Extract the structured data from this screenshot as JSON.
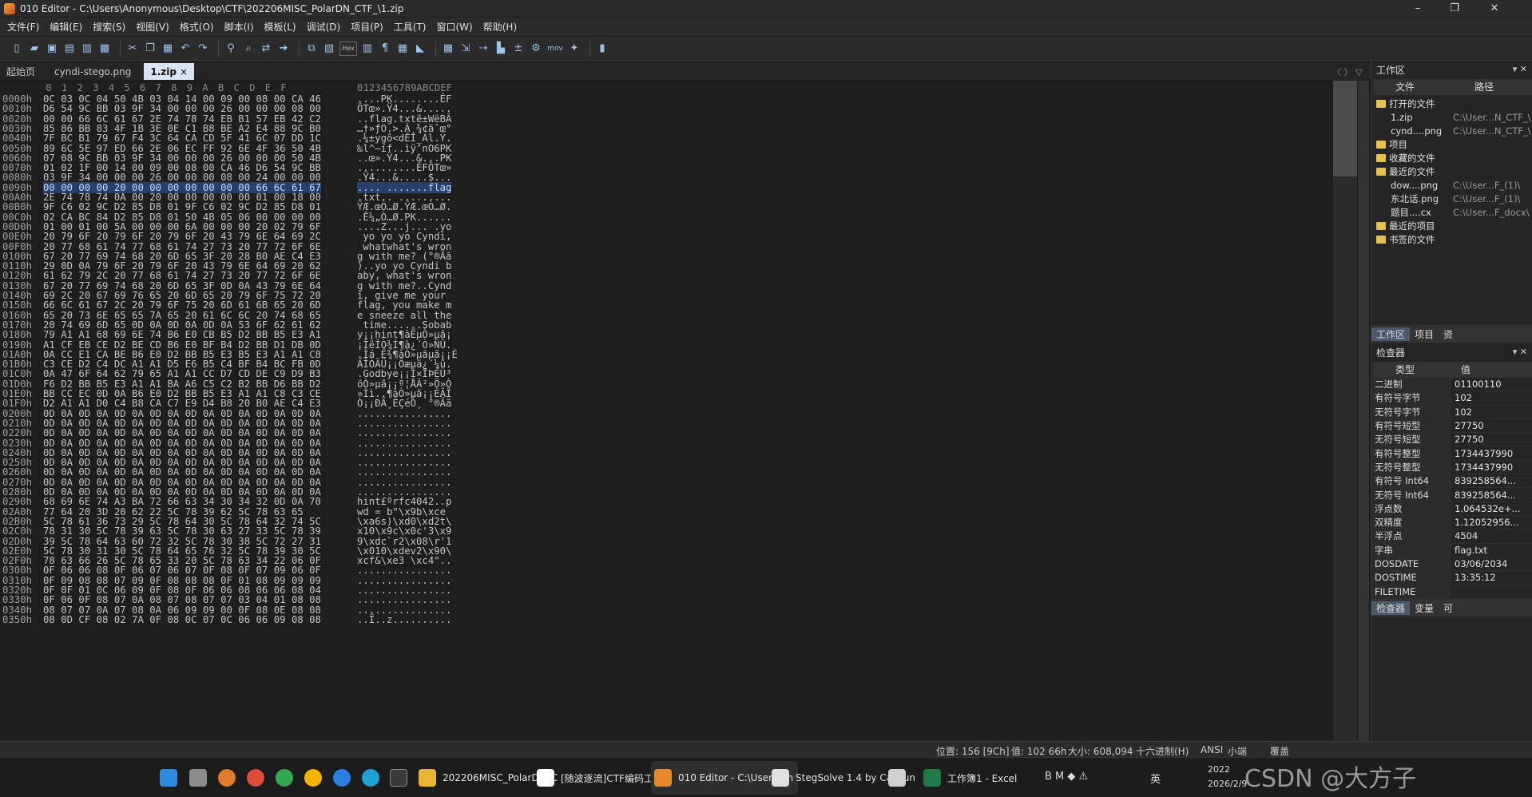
{
  "window": {
    "title": "010 Editor - C:\\Users\\Anonymous\\Desktop\\CTF\\202206MISC_PolarDN_CTF_\\1.zip",
    "minimize": "–",
    "maximize": "❐",
    "close": "✕"
  },
  "menu": [
    "文件(F)",
    "编辑(E)",
    "搜索(S)",
    "视图(V)",
    "格式(O)",
    "脚本(I)",
    "模板(L)",
    "调试(D)",
    "项目(P)",
    "工具(T)",
    "窗口(W)",
    "帮助(H)"
  ],
  "toolbar": {
    "hex_label": "Hex",
    "mov_label": "mov",
    "icons": [
      "new-file-icon",
      "open-folder-icon",
      "save-icon",
      "save-as-icon",
      "save-all-icon",
      "open-workspace-icon",
      "sep",
      "cut-icon",
      "copy-icon",
      "paste-icon",
      "undo-icon",
      "redo-icon",
      "sep",
      "find-icon",
      "find-in-files-icon",
      "replace-icon",
      "goto-icon",
      "sep",
      "compare-icon",
      "template-icon",
      "hex-icon",
      "columns-icon",
      "pilcrow-icon",
      "grid-icon",
      "highlight-icon",
      "sep",
      "calculator-icon",
      "import-icon",
      "export-icon",
      "histogram-icon",
      "checksum-icon",
      "script-icon",
      "mov-icon",
      "tool-icon",
      "sep",
      "pause-icon"
    ]
  },
  "tabs": [
    {
      "label": "起始页",
      "active": false
    },
    {
      "label": "cyndi-stego.png",
      "active": false
    },
    {
      "label": "1.zip",
      "active": true,
      "close": "×"
    }
  ],
  "tab_nav": "〈 〉 ▽",
  "hex": {
    "columns": [
      "0",
      "1",
      "2",
      "3",
      "4",
      "5",
      "6",
      "7",
      "8",
      "9",
      "A",
      "B",
      "C",
      "D",
      "E",
      "F"
    ],
    "ascii_header": "0123456789ABCDEF",
    "rows": [
      {
        "offset": "0000h",
        "hex": "0C 03 0C 04 50 4B 03 04 14 00 09 00 08 00 CA 46",
        "ascii": "....PK........ÊF"
      },
      {
        "offset": "0010h",
        "hex": "D6 54 9C BB 03 9F 34 00 00 00 26 00 00 00 08 00",
        "ascii": "ÖTœ».Ÿ4...&....."
      },
      {
        "offset": "0020h",
        "hex": "00 00 66 6C 61 67 2E 74 78 74 EB B1 57 EB 42 C2",
        "ascii": "..flag.txtë±WëBÂ"
      },
      {
        "offset": "0030h",
        "hex": "85 86 BB 83 4F 1B 3E 0E C1 B8 BE A2 E4 88 9C B0",
        "ascii": "…†»ƒO.>.Á¸¾¢äˆœ°"
      },
      {
        "offset": "0040h",
        "hex": "7F BC B1 79 67 F4 3C 64 CA CD 5F 41 6C 07 DD 1C",
        "ascii": ".¼±ygô<dÊÍ_Al.Ý."
      },
      {
        "offset": "0050h",
        "hex": "89 6C 5E 97 ED 66 2E 06 EC FF 92 6E 4F 36 50 4B",
        "ascii": "‰l^—íf..ìÿ’nO6PK"
      },
      {
        "offset": "0060h",
        "hex": "07 08 9C BB 03 9F 34 00 00 00 26 00 00 00 50 4B",
        "ascii": "..œ».Ÿ4...&...PK"
      },
      {
        "offset": "0070h",
        "hex": "01 02 1F 00 14 00 09 00 08 00 CA 46 D6 54 9C BB",
        "ascii": "..........ÊFÖTœ»"
      },
      {
        "offset": "0080h",
        "hex": "03 9F 34 00 00 00 26 00 00 00 08 00 24 00 00 00",
        "ascii": ".Ÿ4...&.....$..."
      },
      {
        "offset": "0090h",
        "hex": "00 00 00 00 20 00 00 00 00 00 00 00 66 6C 61 67",
        "ascii": ".... .......flag",
        "hl": true
      },
      {
        "offset": "00A0h",
        "hex": "2E 74 78 74 0A 00 20 00 00 00 00 00 01 00 18 00",
        "ascii": ".txt.. ........."
      },
      {
        "offset": "00B0h",
        "hex": "9F C6 02 9C D2 85 D8 01 9F C6 02 9C D2 85 D8 01",
        "ascii": "ŸÆ.œÒ…Ø.ŸÆ.œÒ…Ø."
      },
      {
        "offset": "00C0h",
        "hex": "02 CA BC 84 D2 85 D8 01 50 4B 05 06 00 00 00 00",
        "ascii": ".Ê¼„Ò…Ø.PK......"
      },
      {
        "offset": "00D0h",
        "hex": "01 00 01 00 5A 00 00 00 6A 00 00 00 20 02 79 6F",
        "ascii": "....Z...j... .yo"
      },
      {
        "offset": "00E0h",
        "hex": "20 79 6F 20 79 6F 20 79 6F 20 43 79 6E 64 69 2C",
        "ascii": " yo yo yo Cyndi,"
      },
      {
        "offset": "00F0h",
        "hex": "20 77 68 61 74 77 68 61 74 27 73 20 77 72 6F 6E",
        "ascii": " whatwhat's wron"
      },
      {
        "offset": "0100h",
        "hex": "67 20 77 69 74 68 20 6D 65 3F 20 28 B0 AE C4 E3",
        "ascii": "g with me? (°®Äã"
      },
      {
        "offset": "0110h",
        "hex": "29 0D 0A 79 6F 20 79 6F 20 43 79 6E 64 69 20 62",
        "ascii": ")..yo yo Cyndi b"
      },
      {
        "offset": "0120h",
        "hex": "61 62 79 2C 20 77 68 61 74 27 73 20 77 72 6F 6E",
        "ascii": "aby, what's wron"
      },
      {
        "offset": "0130h",
        "hex": "67 20 77 69 74 68 20 6D 65 3F 0D 0A 43 79 6E 64",
        "ascii": "g with me?..Cynd"
      },
      {
        "offset": "0140h",
        "hex": "69 2C 20 67 69 76 65 20 6D 65 20 79 6F 75 72 20",
        "ascii": "i, give me your "
      },
      {
        "offset": "0150h",
        "hex": "66 6C 61 67 2C 20 79 6F 75 20 6D 61 6B 65 20 6D",
        "ascii": "flag, you make m"
      },
      {
        "offset": "0160h",
        "hex": "65 20 73 6E 65 65 7A 65 20 61 6C 6C 20 74 68 65",
        "ascii": "e sneeze all the"
      },
      {
        "offset": "0170h",
        "hex": "20 74 69 6D 65 0D 0A 0D 0A 0D 0A 53 6F 62 61 62",
        "ascii": " time......Sobab"
      },
      {
        "offset": "0180h",
        "hex": "79 A1 A1 68 69 6E 74 B6 E0 CB B5 D2 BB B5 E3 A1",
        "ascii": "y¡¡hint¶àËµÒ»µã¡"
      },
      {
        "offset": "0190h",
        "hex": "A1 CF EB CE D2 BE CD B6 E0 BF B4 D2 BB D1 DB 0D",
        "ascii": "¡ÏëÎÒ¾Í¶à¿´Ò»ÑÛ."
      },
      {
        "offset": "01A0h",
        "hex": "0A CC E1 CA BE B6 E0 D2 BB B5 E3 B5 E3 A1 A1 C8",
        "ascii": ".Ìá Ê¾¶àÒ»µãµã¡¡È"
      },
      {
        "offset": "01B0h",
        "hex": "C3 CE D2 C4 DC A1 A1 D5 E6 B5 C4 BF B4 BC FB 0D",
        "ascii": "ÃÎÒÄÜ¡¡Õæµä¿´¼û."
      },
      {
        "offset": "01C0h",
        "hex": "0A 47 6F 64 62 79 65 A1 A1 CC D7 CD DE C9 D9 B3",
        "ascii": ".Godbye¡¡Ì×ÍÞÉÙ³"
      },
      {
        "offset": "01D0h",
        "hex": "F6 D2 BB B5 E3 A1 A1 BA A6 C5 C2 B2 BB D6 BB D2",
        "ascii": "öÒ»µã¡¡º¦ÅÂ²»Ö»Ò"
      },
      {
        "offset": "01E0h",
        "hex": "BB CC EC 0D 0A B6 E0 D2 BB B5 E3 A1 A1 C8 C3 CE",
        "ascii": "»Ìì..¶àÒ»µã¡¡ÈÃÎ"
      },
      {
        "offset": "01F0h",
        "hex": "D2 A1 A1 D0 C4 B8 CA C7 E9 D4 B8 20 B0 AE C4 E3",
        "ascii": "Ò¡¡ÐÄ¸ÊÇéÔ¸ °®Äã"
      },
      {
        "offset": "0200h",
        "hex": "0D 0A 0D 0A 0D 0A 0D 0A 0D 0A 0D 0A 0D 0A 0D 0A",
        "ascii": "................"
      },
      {
        "offset": "0210h",
        "hex": "0D 0A 0D 0A 0D 0A 0D 0A 0D 0A 0D 0A 0D 0A 0D 0A",
        "ascii": "................"
      },
      {
        "offset": "0220h",
        "hex": "0D 0A 0D 0A 0D 0A 0D 0A 0D 0A 0D 0A 0D 0A 0D 0A",
        "ascii": "................"
      },
      {
        "offset": "0230h",
        "hex": "0D 0A 0D 0A 0D 0A 0D 0A 0D 0A 0D 0A 0D 0A 0D 0A",
        "ascii": "................"
      },
      {
        "offset": "0240h",
        "hex": "0D 0A 0D 0A 0D 0A 0D 0A 0D 0A 0D 0A 0D 0A 0D 0A",
        "ascii": "................"
      },
      {
        "offset": "0250h",
        "hex": "0D 0A 0D 0A 0D 0A 0D 0A 0D 0A 0D 0A 0D 0A 0D 0A",
        "ascii": "................"
      },
      {
        "offset": "0260h",
        "hex": "0D 0A 0D 0A 0D 0A 0D 0A 0D 0A 0D 0A 0D 0A 0D 0A",
        "ascii": "................"
      },
      {
        "offset": "0270h",
        "hex": "0D 0A 0D 0A 0D 0A 0D 0A 0D 0A 0D 0A 0D 0A 0D 0A",
        "ascii": "................"
      },
      {
        "offset": "0280h",
        "hex": "0D 0A 0D 0A 0D 0A 0D 0A 0D 0A 0D 0A 0D 0A 0D 0A",
        "ascii": "................"
      },
      {
        "offset": "0290h",
        "hex": "68 69 6E 74 A3 BA 72 66 63 34 30 34 32 0D 0A 70",
        "ascii": "hint£ºrfc4042..p"
      },
      {
        "offset": "02A0h",
        "hex": "77 64 20 3D 20 62 22 5C 78 39 62 5C 78 63 65",
        "ascii": "wd = b\"\\x9b\\xce"
      },
      {
        "offset": "02B0h",
        "hex": "5C 78 61 36 73 29 5C 78 64 30 5C 78 64 32 74 5C",
        "ascii": "\\xa6s)\\xd0\\xd2t\\"
      },
      {
        "offset": "02C0h",
        "hex": "78 31 30 5C 78 39 63 5C 78 30 63 27 33 5C 78 39",
        "ascii": "x10\\x9c\\x0c'3\\x9"
      },
      {
        "offset": "02D0h",
        "hex": "39 5C 78 64 63 60 72 32 5C 78 30 38 5C 72 27 31",
        "ascii": "9\\xdc`r2\\x08\\r'1"
      },
      {
        "offset": "02E0h",
        "hex": "5C 78 30 31 30 5C 78 64 65 76 32 5C 78 39 30 5C",
        "ascii": "\\x010\\xdev2\\x90\\"
      },
      {
        "offset": "02F0h",
        "hex": "78 63 66 26 5C 78 65 33 20 5C 78 63 34 22 06 0F",
        "ascii": "xcf&\\xe3 \\xc4\".."
      },
      {
        "offset": "0300h",
        "hex": "0F 06 06 08 0F 06 07 06 07 0F 08 0F 07 09 06 0F",
        "ascii": "................"
      },
      {
        "offset": "0310h",
        "hex": "0F 09 08 08 07 09 0F 08 08 08 0F 01 08 09 09 09",
        "ascii": "................"
      },
      {
        "offset": "0320h",
        "hex": "0F 0F 01 0C 06 09 0F 08 0F 06 06 08 06 06 08 04",
        "ascii": "................"
      },
      {
        "offset": "0330h",
        "hex": "0F 06 0F 08 07 0A 08 07 08 07 07 03 04 01 08 08",
        "ascii": "................"
      },
      {
        "offset": "0340h",
        "hex": "08 07 07 0A 07 08 0A 06 09 09 00 0F 08 0E 08 08",
        "ascii": "................"
      },
      {
        "offset": "0350h",
        "hex": "08 0D CF 08 02 7A 0F 08 0C 07 0C 06 06 09 08 08",
        "ascii": "..Ï..z.........."
      }
    ]
  },
  "workspace": {
    "title": "工作区",
    "controls": "▾ ✕",
    "col_file": "文件",
    "col_path": "路径",
    "tree": [
      {
        "name": "打开的文件",
        "path": "",
        "level": 0,
        "folder": true
      },
      {
        "name": "1.zip",
        "path": "C:\\User...N_CTF_\\",
        "level": 1,
        "folder": false
      },
      {
        "name": "cynd....png",
        "path": "C:\\User...N_CTF_\\",
        "level": 1,
        "folder": false
      },
      {
        "name": "项目",
        "path": "",
        "level": 0,
        "folder": true
      },
      {
        "name": "收藏的文件",
        "path": "",
        "level": 0,
        "folder": true
      },
      {
        "name": "最近的文件",
        "path": "",
        "level": 0,
        "folder": true
      },
      {
        "name": "dow....png",
        "path": "C:\\User...F_(1)\\",
        "level": 1,
        "folder": false
      },
      {
        "name": "东北话.png",
        "path": "C:\\User...F_(1)\\",
        "level": 1,
        "folder": false
      },
      {
        "name": "题目....cx",
        "path": "C:\\User...F_docx\\",
        "level": 1,
        "folder": false
      },
      {
        "name": "最近的项目",
        "path": "",
        "level": 0,
        "folder": true
      },
      {
        "name": "书签的文件",
        "path": "",
        "level": 0,
        "folder": true
      }
    ],
    "tabs": [
      "工作区",
      "项目",
      "资"
    ]
  },
  "inspector": {
    "title": "检查器",
    "controls": "▾ ✕",
    "col_type": "类型",
    "col_value": "值",
    "rows": [
      {
        "type": "二进制",
        "value": "01100110"
      },
      {
        "type": "有符号字节",
        "value": "102"
      },
      {
        "type": "无符号字节",
        "value": "102"
      },
      {
        "type": "有符号短型",
        "value": "27750"
      },
      {
        "type": "无符号短型",
        "value": "27750"
      },
      {
        "type": "有符号整型",
        "value": "1734437990"
      },
      {
        "type": "无符号整型",
        "value": "1734437990"
      },
      {
        "type": "有符号 Int64",
        "value": "839258564..."
      },
      {
        "type": "无符号 Int64",
        "value": "839258564..."
      },
      {
        "type": "浮点数",
        "value": "1.064532e+..."
      },
      {
        "type": "双精度",
        "value": "1.12052956..."
      },
      {
        "type": "半浮点",
        "value": "4504"
      },
      {
        "type": "字串",
        "value": "flag.txt"
      },
      {
        "type": "DOSDATE",
        "value": "03/06/2034"
      },
      {
        "type": "DOSTIME",
        "value": "13:35:12"
      },
      {
        "type": "FILETIME",
        "value": ""
      }
    ],
    "tabs": [
      "检查器",
      "变量",
      "可"
    ]
  },
  "status": {
    "position": "位置: 156 [9Ch]",
    "value": "值: 102 66h",
    "size": "大小: 608,094",
    "mode": "十六进制(H)",
    "encoding": "ANSI",
    "endian": "小端",
    "overwrite": "覆盖"
  },
  "taskbar": {
    "apps": [
      {
        "label": "202206MISC_PolarDN_C",
        "color": "#e8b431",
        "active": false
      },
      {
        "label": "[随波逐流]CTF编码工具",
        "color": "#ffffff",
        "active": false
      },
      {
        "label": "010 Editor - C:\\Users\\An",
        "color": "#e58a2a",
        "active": true
      },
      {
        "label": "StegSolve 1.4 by Caesun",
        "color": "#e0e0e0",
        "active": false
      },
      {
        "label": "",
        "color": "#d0d0d0",
        "active": false
      },
      {
        "label": "工作簿1 - Excel",
        "color": "#1f7a45",
        "active": false
      }
    ],
    "tray_lang": "英",
    "clock_time": "2022",
    "clock_date": "2026/2/9"
  },
  "watermark": "CSDN @大方子"
}
